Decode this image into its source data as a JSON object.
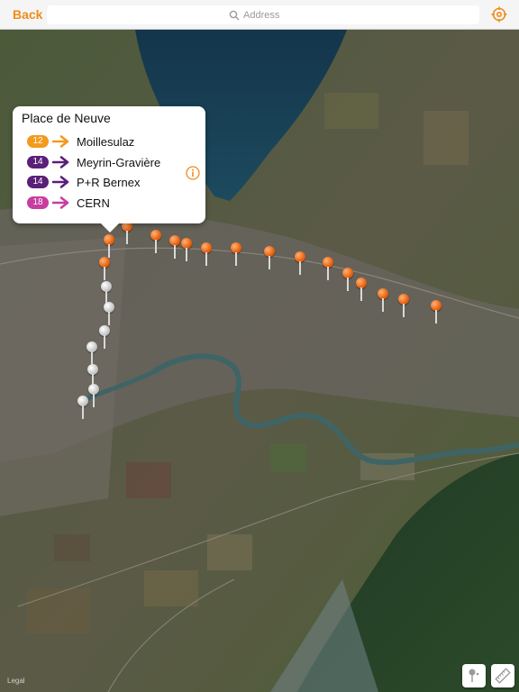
{
  "nav": {
    "back_label": "Back",
    "search_placeholder": "Address"
  },
  "callout": {
    "title": "Place de Neuve",
    "routes": [
      {
        "line": "12",
        "destination": "Moillesulaz",
        "color": "#f39a1d"
      },
      {
        "line": "14",
        "destination": "Meyrin-Gravière",
        "color": "#5b1f78"
      },
      {
        "line": "14",
        "destination": "P+R Bernex",
        "color": "#5b1f78"
      },
      {
        "line": "18",
        "destination": "CERN",
        "color": "#c83da0"
      }
    ]
  },
  "map": {
    "legal_label": "Legal"
  },
  "colors": {
    "accent": "#f08c1a",
    "pin_orange": "#e8620e",
    "pin_grey": "#c7c7c7"
  },
  "icons": {
    "locate": "location-icon",
    "search": "search-icon",
    "info": "info-icon",
    "drop_pin": "drop-pin-icon",
    "ruler": "ruler-icon"
  }
}
